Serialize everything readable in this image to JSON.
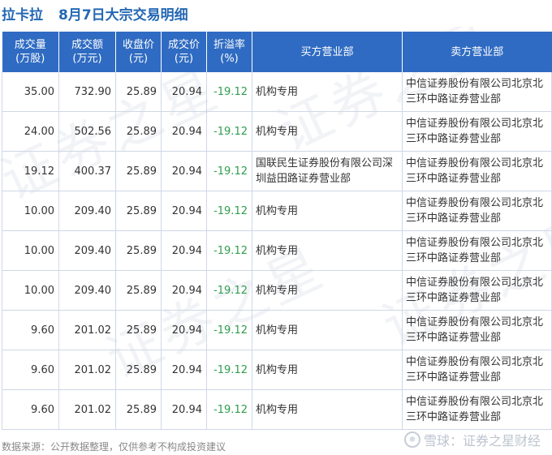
{
  "title": {
    "stock": "拉卡拉",
    "subtitle": "8月7日大宗交易明细"
  },
  "table": {
    "headers": [
      [
        "成交量",
        "(万股)"
      ],
      [
        "成交额",
        "(万元)"
      ],
      [
        "收盘价",
        "(元)"
      ],
      [
        "成交价",
        "(元)"
      ],
      [
        "折溢率",
        "(%)"
      ],
      [
        "买方营业部"
      ],
      [
        "卖方营业部"
      ]
    ],
    "rows": [
      {
        "volume": "35.00",
        "amount": "732.90",
        "close": "25.89",
        "price": "20.94",
        "premium": "-19.12",
        "buyer": "机构专用",
        "seller": "中信证券股份有限公司北京北三环中路证券营业部"
      },
      {
        "volume": "24.00",
        "amount": "502.56",
        "close": "25.89",
        "price": "20.94",
        "premium": "-19.12",
        "buyer": "机构专用",
        "seller": "中信证券股份有限公司北京北三环中路证券营业部"
      },
      {
        "volume": "19.12",
        "amount": "400.37",
        "close": "25.89",
        "price": "20.94",
        "premium": "-19.12",
        "buyer": "国联民生证券股份有限公司深圳益田路证券营业部",
        "seller": "中信证券股份有限公司北京北三环中路证券营业部"
      },
      {
        "volume": "10.00",
        "amount": "209.40",
        "close": "25.89",
        "price": "20.94",
        "premium": "-19.12",
        "buyer": "机构专用",
        "seller": "中信证券股份有限公司北京北三环中路证券营业部"
      },
      {
        "volume": "10.00",
        "amount": "209.40",
        "close": "25.89",
        "price": "20.94",
        "premium": "-19.12",
        "buyer": "机构专用",
        "seller": "中信证券股份有限公司北京北三环中路证券营业部"
      },
      {
        "volume": "10.00",
        "amount": "209.40",
        "close": "25.89",
        "price": "20.94",
        "premium": "-19.12",
        "buyer": "机构专用",
        "seller": "中信证券股份有限公司北京北三环中路证券营业部"
      },
      {
        "volume": "9.60",
        "amount": "201.02",
        "close": "25.89",
        "price": "20.94",
        "premium": "-19.12",
        "buyer": "机构专用",
        "seller": "中信证券股份有限公司北京北三环中路证券营业部"
      },
      {
        "volume": "9.60",
        "amount": "201.02",
        "close": "25.89",
        "price": "20.94",
        "premium": "-19.12",
        "buyer": "机构专用",
        "seller": "中信证券股份有限公司北京北三环中路证券营业部"
      },
      {
        "volume": "9.60",
        "amount": "201.02",
        "close": "25.89",
        "price": "20.94",
        "premium": "-19.12",
        "buyer": "机构专用",
        "seller": "中信证券股份有限公司北京北三环中路证券营业部"
      }
    ]
  },
  "watermark": "证券之星",
  "footer": "数据来源：公开数据整理，仅供参考不构成投资建议",
  "brand": "雪球：证券之星财经",
  "colors": {
    "title": "#2468b3",
    "header_bg": "#2f6bc2",
    "negative": "#2e9e4e",
    "grid": "#cfd8e6"
  }
}
